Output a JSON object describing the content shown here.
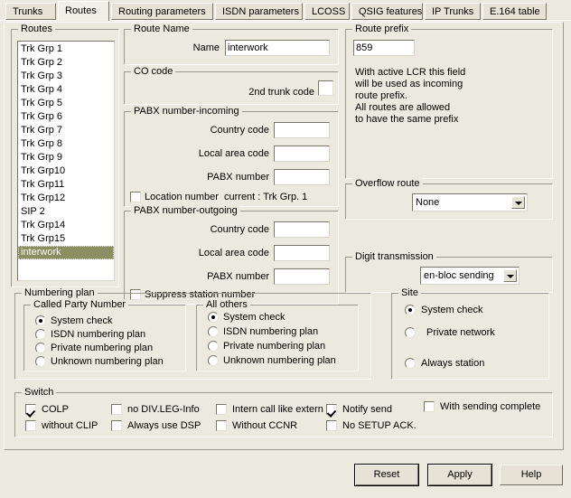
{
  "tabs": [
    {
      "label": "Trunks",
      "active": false
    },
    {
      "label": "Routes",
      "active": true
    },
    {
      "label": "Routing parameters",
      "active": false
    },
    {
      "label": "ISDN parameters",
      "active": false
    },
    {
      "label": "LCOSS",
      "active": false
    },
    {
      "label": "QSIG features",
      "active": false
    },
    {
      "label": "IP Trunks",
      "active": false
    },
    {
      "label": "E.164 table",
      "active": false
    }
  ],
  "routes": {
    "legend": "Routes",
    "items": [
      "Trk Grp 1",
      "Trk Grp 2",
      "Trk Grp 3",
      "Trk Grp 4",
      "Trk Grp 5",
      "Trk Grp 6",
      "Trk Grp 7",
      "Trk Grp 8",
      "Trk Grp 9",
      "Trk Grp10",
      "Trk Grp11",
      "Trk Grp12",
      "SIP 2",
      "Trk Grp14",
      "Trk Grp15",
      "interwork"
    ],
    "selected_index": 15,
    "selection_color": "#8a8e60"
  },
  "route_name": {
    "legend": "Route Name",
    "name_label": "Name",
    "name_value": "interwork"
  },
  "co_code": {
    "legend": "CO code",
    "second_trunk_label": "2nd trunk code",
    "second_trunk_checked": false
  },
  "pabx_incoming": {
    "legend": "PABX number-incoming",
    "country_code_label": "Country code",
    "country_code_value": "",
    "local_area_code_label": "Local area code",
    "local_area_code_value": "",
    "pabx_number_label": "PABX number",
    "pabx_number_value": "",
    "location_number_label": "Location number",
    "location_number_checked": false,
    "current_label": "current : Trk Grp. 1"
  },
  "pabx_outgoing": {
    "legend": "PABX number-outgoing",
    "country_code_label": "Country code",
    "country_code_value": "",
    "local_area_code_label": "Local area code",
    "local_area_code_value": "",
    "pabx_number_label": "PABX number",
    "pabx_number_value": "",
    "suppress_label": "Suppress station number",
    "suppress_checked": false
  },
  "route_prefix": {
    "legend": "Route prefix",
    "value": "859",
    "help": "With active LCR this field\nwill be used as incoming\nroute prefix.\nAll routes are allowed\nto have the same prefix"
  },
  "overflow_route": {
    "legend": "Overflow route",
    "value": "None"
  },
  "digit_transmission": {
    "legend": "Digit transmission",
    "value": "en-bloc sending"
  },
  "numbering_plan": {
    "legend": "Numbering plan",
    "called_party": {
      "legend": "Called Party Number",
      "options": [
        "System check",
        "ISDN numbering plan",
        "Private numbering plan",
        "Unknown numbering plan"
      ],
      "selected_index": 0
    },
    "all_others": {
      "legend": "All others",
      "options": [
        "System check",
        "ISDN numbering plan",
        "Private numbering plan",
        "Unknown numbering plan"
      ],
      "selected_index": 0
    }
  },
  "site": {
    "legend": "Site",
    "options": [
      "System check",
      "Private network",
      "Always station"
    ],
    "selected_index": 0
  },
  "switch": {
    "legend": "Switch",
    "items": [
      {
        "label": "COLP",
        "checked": true
      },
      {
        "label": "without CLIP",
        "checked": false
      },
      {
        "label": "no DIV.LEG-Info",
        "checked": false
      },
      {
        "label": "Always use DSP",
        "checked": false
      },
      {
        "label": "Intern call like extern",
        "checked": false
      },
      {
        "label": "Without CCNR",
        "checked": false
      },
      {
        "label": "Notify send",
        "checked": true
      },
      {
        "label": "No SETUP ACK.",
        "checked": false
      },
      {
        "label": "With sending complete",
        "checked": false
      }
    ]
  },
  "buttons": {
    "reset": "Reset",
    "apply": "Apply",
    "help": "Help"
  }
}
